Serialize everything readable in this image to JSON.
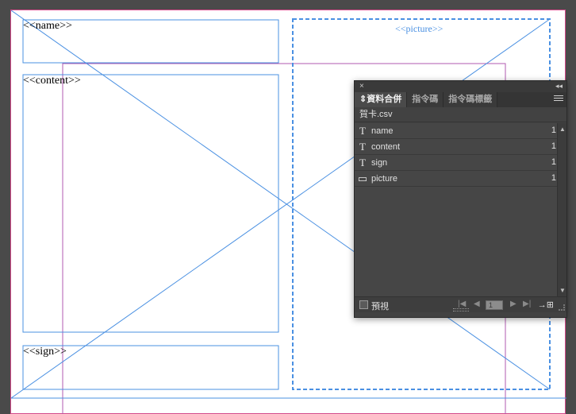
{
  "document": {
    "frames": {
      "name_label": "<<name>>",
      "content_label": "<<content>>",
      "sign_label": "<<sign>>",
      "picture_label": "<<picture>>"
    }
  },
  "panel": {
    "close_glyph": "×",
    "collapse_glyph": "◂◂",
    "tabs": [
      {
        "label": "⇕資料合併",
        "active": true
      },
      {
        "label": "指令碼",
        "active": false
      },
      {
        "label": "指令碼標籤",
        "active": false
      }
    ],
    "source_file": "賀卡.csv",
    "fields": [
      {
        "icon": "T",
        "icon_name": "text-field-icon",
        "label": "name",
        "count": "1"
      },
      {
        "icon": "T",
        "icon_name": "text-field-icon",
        "label": "content",
        "count": "1"
      },
      {
        "icon": "T",
        "icon_name": "text-field-icon",
        "label": "sign",
        "count": "1"
      },
      {
        "icon": "▭",
        "icon_name": "image-field-icon",
        "label": "picture",
        "count": "1"
      }
    ],
    "preview_label": "預視",
    "record_number": "1",
    "nav": {
      "first": "|◀",
      "prev": "◀",
      "next": "▶",
      "last": "▶|"
    },
    "merge_glyph": "→⊞"
  },
  "colors": {
    "frame_blue": "#4a90e2",
    "margin_magenta": "#d44a8a",
    "panel_bg": "#424242"
  }
}
